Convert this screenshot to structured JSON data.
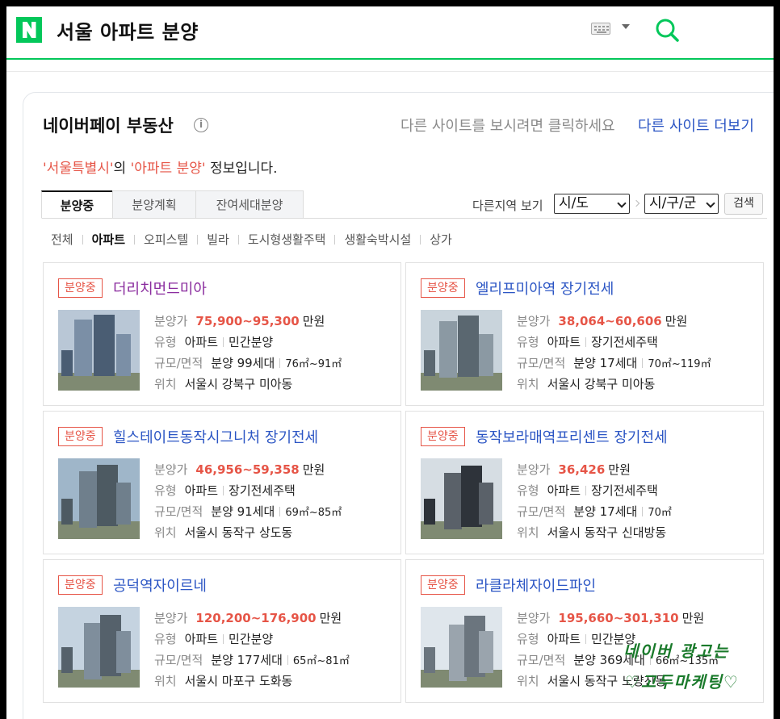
{
  "header": {
    "query": "서울 아파트 분양",
    "logo": "N",
    "keyboard_icon": "keyboard-icon",
    "search_icon": "search-icon",
    "accent": "#03c75a"
  },
  "panel": {
    "title": "네이버페이 부동산",
    "other_hint": "다른 사이트를 보시려면 클릭하세요",
    "other_link": "다른 사이트 더보기",
    "sentence": {
      "q1": "'서울특별시'",
      "p1": "의 ",
      "q2": "'아파트 분양'",
      "p2": " 정보입니다."
    }
  },
  "tabs": [
    "분양중",
    "분양계획",
    "잔여세대분양"
  ],
  "region": {
    "label": "다른지역 보기",
    "sido": "시/도",
    "sigungu": "시/구/군",
    "search": "검색"
  },
  "subcats": [
    "전체",
    "아파트",
    "오피스텔",
    "빌라",
    "도시형생활주택",
    "생활숙박시설",
    "상가"
  ],
  "labels": {
    "price": "분양가",
    "type": "유형",
    "scale": "규모/면적",
    "loc": "위치",
    "unit": "만원"
  },
  "cards": [
    {
      "badge": "분양중",
      "name": "더리치먼드미아",
      "price": "75,900~95,300",
      "type1": "아파트",
      "type2": "민간분양",
      "scale1": "분양 99세대",
      "scale2": "76㎡~91㎡",
      "loc": "서울시 강북구 미아동"
    },
    {
      "badge": "분양중",
      "name": "엘리프미아역 장기전세",
      "price": "38,064~60,606",
      "type1": "아파트",
      "type2": "장기전세주택",
      "scale1": "분양 17세대",
      "scale2": "70㎡~119㎡",
      "loc": "서울시 강북구 미아동"
    },
    {
      "badge": "분양중",
      "name": "힐스테이트동작시그니처 장기전세",
      "price": "46,956~59,358",
      "type1": "아파트",
      "type2": "장기전세주택",
      "scale1": "분양 91세대",
      "scale2": "69㎡~85㎡",
      "loc": "서울시 동작구 상도동"
    },
    {
      "badge": "분양중",
      "name": "동작보라매역프리센트 장기전세",
      "price": "36,426",
      "type1": "아파트",
      "type2": "장기전세주택",
      "scale1": "분양 17세대",
      "scale2": "70㎡",
      "loc": "서울시 동작구 신대방동"
    },
    {
      "badge": "분양중",
      "name": "공덕역자이르네",
      "price": "120,200~176,900",
      "type1": "아파트",
      "type2": "민간분양",
      "scale1": "분양 177세대",
      "scale2": "65㎡~81㎡",
      "loc": "서울시 마포구 도화동"
    },
    {
      "badge": "분양중",
      "name": "라클라체자이드파인",
      "price": "195,660~301,310",
      "type1": "아파트",
      "type2": "민간분양",
      "scale1": "분양 369세대",
      "scale2": "66㎡~135㎡",
      "loc": "서울시 동작구 노량진동"
    }
  ],
  "watermark": {
    "line1": "네이버 광고는",
    "line2": "♡고두마케팅♡"
  }
}
